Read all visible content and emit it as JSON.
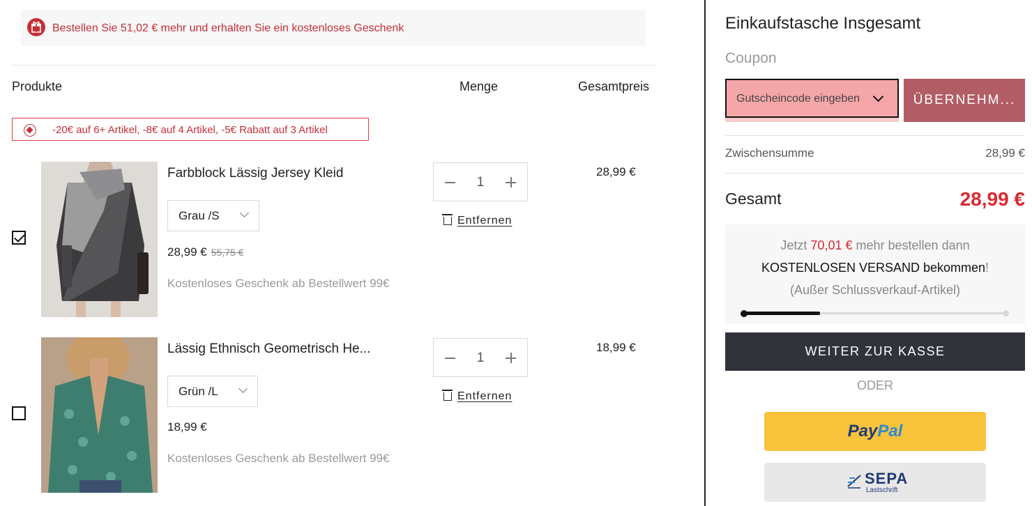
{
  "gift_banner": {
    "text": "Bestellen Sie 51,02 € mehr und erhalten Sie ein kostenloses Geschenk",
    "color": "#c62f39",
    "icon": "gift-icon"
  },
  "cart_header": {
    "products": "Produkte",
    "quantity": "Menge",
    "total": "Gesamtpreis"
  },
  "promo": {
    "text": "-20€ auf 6+ Artikel, -8€ auf 4 Artikel, -5€ Rabatt auf 3 Artikel",
    "icon": "tag-icon"
  },
  "items": [
    {
      "checked": true,
      "name": "Farbblock Lässig Jersey Kleid",
      "variant": "Grau /S",
      "price": "28,99 €",
      "old_price": "55,75 €",
      "gift_note": "Kostenloses Geschenk ab Bestellwert 99€",
      "quantity": "1",
      "remove_label": "Entfernen",
      "total": "28,99 €"
    },
    {
      "checked": false,
      "name": "Lässig Ethnisch Geometrisch He...",
      "variant": "Grün /L",
      "price": "18,99 €",
      "old_price": "",
      "gift_note": "Kostenloses Geschenk ab Bestellwert 99€",
      "quantity": "1",
      "remove_label": "Entfernen",
      "total": "18,99 €"
    }
  ],
  "summary": {
    "title": "Einkaufstasche Insgesamt",
    "coupon_label": "Coupon",
    "coupon_placeholder": "Gutscheincode eingeben",
    "apply_label": "ÜBERNEHM...",
    "subtotal_label": "Zwischensumme",
    "subtotal_value": "28,99 €",
    "total_label": "Gesamt",
    "total_value": "28,99 €",
    "shipping": {
      "line1_pre": "Jetzt",
      "line1_amount": "70,01 €",
      "line1_post": "mehr bestellen dann",
      "line2": "KOSTENLOSEN VERSAND bekommen",
      "line2_mark": "!",
      "line3": "(Außer Schlussverkauf-Artikel)",
      "progress_fraction": 0.29
    },
    "checkout_label": "WEITER ZUR KASSE",
    "or_label": "ODER",
    "paypal_part1": "Pay",
    "paypal_part2": "Pal",
    "sepa_word": "SEPA",
    "sepa_sub": "Lastschrift",
    "accent_color": "#d92a2e",
    "checkout_color": "#30333a"
  }
}
